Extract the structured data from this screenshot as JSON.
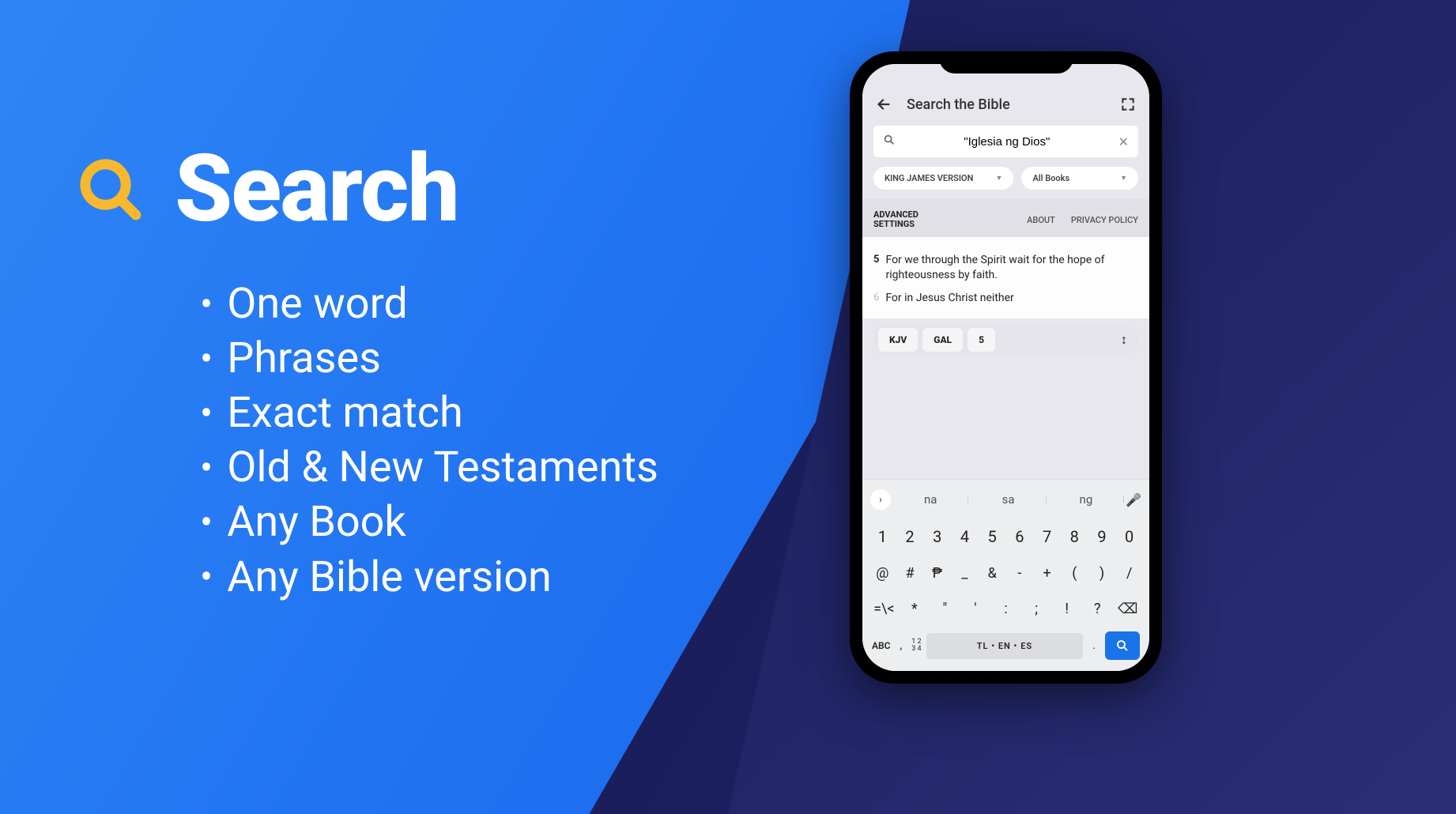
{
  "marketing": {
    "title": "Search",
    "bullets": [
      "One word",
      "Phrases",
      "Exact match",
      "Old & New Testaments",
      "Any Book",
      "Any Bible version"
    ]
  },
  "app": {
    "header_title": "Search the Bible",
    "search_value": "\"Iglesia ng Dios\"",
    "version_chip": "KING JAMES VERSION",
    "books_chip": "All Books",
    "tabs": {
      "advanced": "ADVANCED SETTINGS",
      "about": "ABOUT",
      "privacy": "PRIVACY POLICY"
    },
    "verses": [
      {
        "num": "5",
        "text": "For we through the Spirit wait for the hope of righteousness by faith.",
        "dim": false
      },
      {
        "num": "6",
        "text": "For in Jesus Christ neither",
        "dim": true
      }
    ],
    "nav": {
      "version": "KJV",
      "book": "GAL",
      "chapter": "5"
    }
  },
  "keyboard": {
    "suggestions": [
      "na",
      "sa",
      "ng"
    ],
    "row1": [
      "1",
      "2",
      "3",
      "4",
      "5",
      "6",
      "7",
      "8",
      "9",
      "0"
    ],
    "row2": [
      "@",
      "#",
      "₱",
      "_",
      "&",
      "-",
      "+",
      "(",
      ")",
      "/"
    ],
    "row3": [
      "=\\<",
      "*",
      "\"",
      "'",
      ":",
      ";",
      "!",
      "?",
      "⌫"
    ],
    "abc": "ABC",
    "comma": ",",
    "nums": "1 2\n3 4",
    "space": "TL • EN • ES",
    "period": "."
  }
}
